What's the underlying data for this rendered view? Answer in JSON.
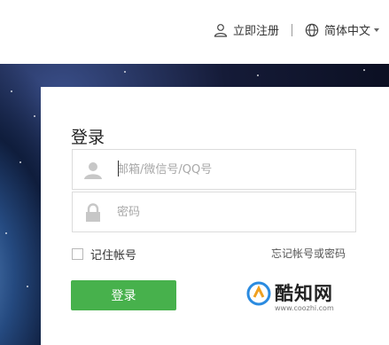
{
  "header": {
    "register_label": "立即注册",
    "language_label": "简体中文"
  },
  "login": {
    "title": "登录",
    "username_placeholder": "邮箱/微信号/QQ号",
    "password_placeholder": "密码",
    "remember_label": "记住帐号",
    "forgot_label": "忘记帐号或密码",
    "submit_label": "登录"
  },
  "watermark": {
    "brand": "酷知网",
    "url": "www.coozhi.com"
  },
  "colors": {
    "accent_green": "#47b14c"
  }
}
